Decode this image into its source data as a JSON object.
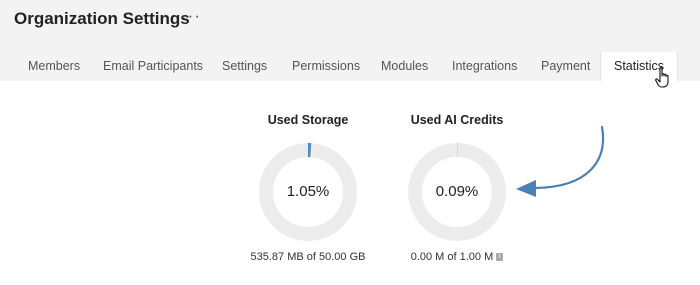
{
  "header": {
    "title": "Organization Settings",
    "more_icon": "more-horizontal-icon",
    "more_label": "···"
  },
  "tabs": [
    {
      "label": "Members"
    },
    {
      "label": "Email Participants"
    },
    {
      "label": "Settings"
    },
    {
      "label": "Permissions"
    },
    {
      "label": "Modules"
    },
    {
      "label": "Integrations"
    },
    {
      "label": "Payment"
    },
    {
      "label": "Statistics",
      "active": true
    }
  ],
  "stats": {
    "storage": {
      "title": "Used Storage",
      "percent_label": "1.05%",
      "fraction": 0.0105,
      "footer": "535.87 MB of 50.00 GB"
    },
    "ai_credits": {
      "title": "Used AI Credits",
      "percent_label": "0.09%",
      "fraction": 0.0009,
      "footer": "0.00 M of 1.00 M",
      "info_icon": "info-icon"
    }
  },
  "colors": {
    "accent": "#4a8cc7",
    "ring_track": "#ececec",
    "header_bg": "#f3f3f3"
  },
  "annotation_icon": "curved-arrow-icon",
  "cursor_icon": "hand-pointer-icon"
}
